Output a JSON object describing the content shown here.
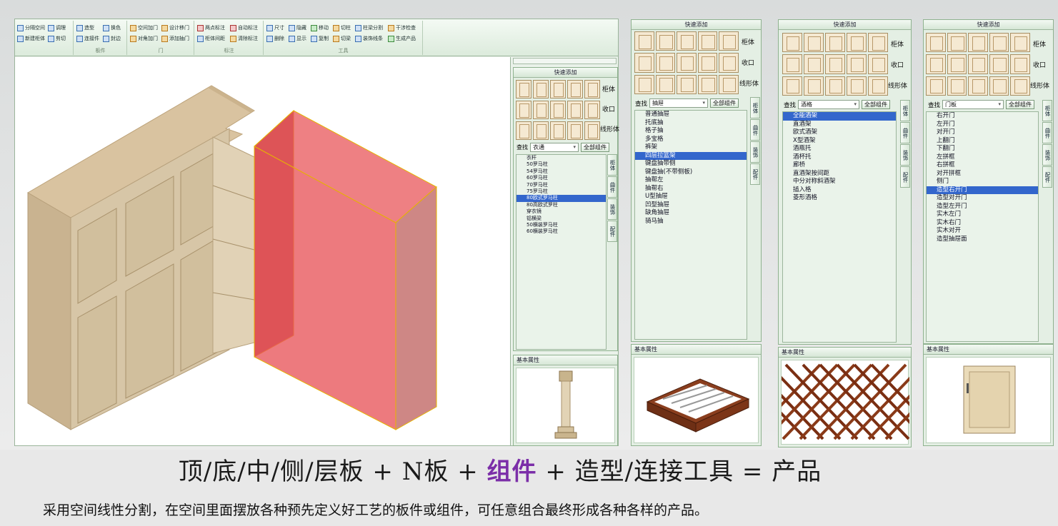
{
  "ribbon": {
    "groups": [
      {
        "label": "",
        "buttons": [
          "分隔空间",
          "调理",
          "新建柜体",
          "剪切"
        ]
      },
      {
        "label": "板件",
        "buttons": [
          "造型",
          "换色",
          "连接件",
          "封边"
        ]
      },
      {
        "label": "门",
        "buttons": [
          "空间加门",
          "设计移门",
          "对角加门",
          "添加抽门"
        ]
      },
      {
        "label": "标注",
        "buttons": [
          "两点标注",
          "自动标注",
          "柜体间距",
          "清除标注"
        ]
      },
      {
        "label": "工具",
        "buttons": [
          "尺寸",
          "隐藏",
          "移动",
          "切柱",
          "柱梁分割",
          "干涉检查",
          "删除",
          "显示",
          "复制",
          "切梁",
          "装饰线条",
          "生成产品"
        ]
      }
    ]
  },
  "panel_main": {
    "title": "快速添加",
    "thumb_labels": [
      "柜体",
      "收口",
      "线形体"
    ],
    "search_label": "查找",
    "search_value": "衣通",
    "all_button": "全部组件",
    "items": [
      "衣杆",
      "50罗马柱",
      "54罗马柱",
      "60罗马柱",
      "70罗马柱",
      "75罗马柱",
      "80欧式罗马柱",
      "80高欧式罗柱",
      "穿衣镜",
      "铝横梁",
      "50横装罗马柱",
      "60横装罗马柱"
    ],
    "selected_index": 6,
    "tabs": [
      "柜体",
      "曲件",
      "装饰",
      "配件"
    ],
    "props_title": "基本属性"
  },
  "panel_drawer": {
    "title": "快速添加",
    "thumb_labels": [
      "柜体",
      "收口",
      "线形体"
    ],
    "search_label": "查找",
    "search_value": "抽屉",
    "all_button": "全部组件",
    "items": [
      "普通抽屉",
      "托底抽",
      "格子抽",
      "多宝格",
      "裤架",
      "四层拉篮架",
      "键盘抽带侧",
      "键盘抽(不带侧板)",
      "抽帮左",
      "抽帮右",
      "U型抽屉",
      "凹型抽屉",
      "缺角抽屉",
      "骑马抽"
    ],
    "selected_index": 5,
    "tabs": [
      "柜体",
      "曲件",
      "装饰",
      "配件"
    ],
    "props_title": "基本属性"
  },
  "panel_wine": {
    "title": "快速添加",
    "thumb_labels": [
      "柜体",
      "收口",
      "线形体"
    ],
    "search_label": "查找",
    "search_value": "酒格",
    "all_button": "全部组件",
    "items": [
      "全能酒架",
      "直酒架",
      "欧式酒架",
      "X型酒架",
      "酒瓶托",
      "酒杯托",
      "廊桥",
      "直酒架按间距",
      "中分对称斜酒架",
      "插入格",
      "菱形酒格"
    ],
    "selected_index": 0,
    "tabs": [
      "柜体",
      "曲件",
      "装饰",
      "配件"
    ],
    "props_title": "基本属性"
  },
  "panel_door": {
    "title": "快速添加",
    "thumb_labels": [
      "柜体",
      "收口",
      "线形体"
    ],
    "search_label": "查找",
    "search_value": "门板",
    "all_button": "全部组件",
    "items": [
      "右开门",
      "左开门",
      "对开门",
      "上翻门",
      "下翻门",
      "左拼框",
      "右拼框",
      "对开拼框",
      "侧门",
      "造型右开门",
      "造型对开门",
      "造型左开门",
      "实木左门",
      "实木右门",
      "实木对开",
      "造型抽屉面"
    ],
    "selected_index": 9,
    "tabs": [
      "柜体",
      "曲件",
      "装饰",
      "配件"
    ],
    "props_title": "基本属性"
  },
  "formula": {
    "part1": "顶/底/中/侧/层板 + N板 + ",
    "highlight": "组件",
    "part2": " + 造型/连接工具 = 产品"
  },
  "description": "采用空间线性分割，在空间里面摆放各种预先定义好工艺的板件或组件，可任意组合最终形成各种各样的产品。",
  "colors": {
    "accent": "#7b2ea8",
    "selection": "#3366cc",
    "panel_bg": "#e4efe4",
    "highlight_box": "#e8555a"
  }
}
